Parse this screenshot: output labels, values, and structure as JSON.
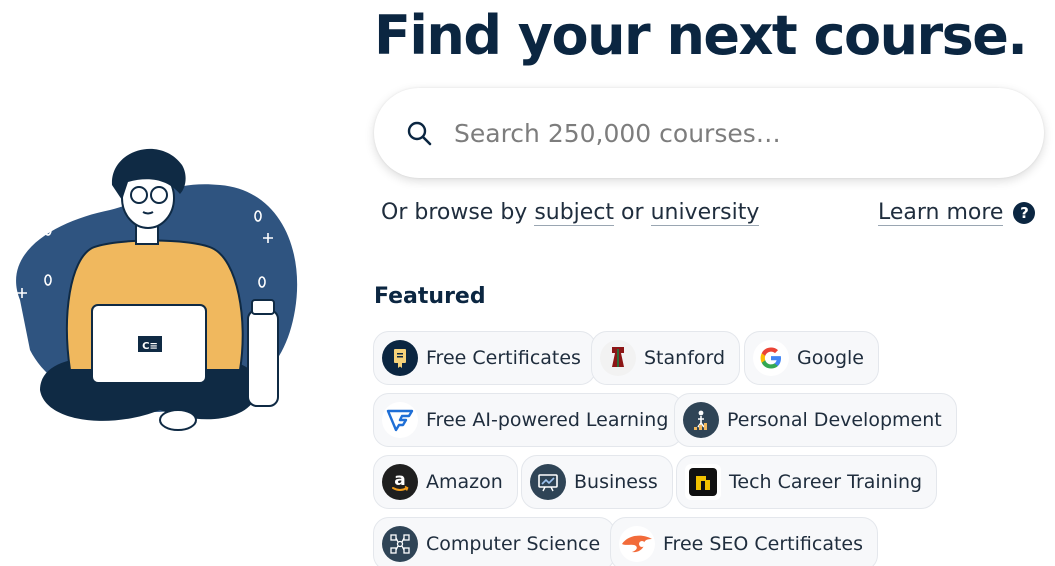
{
  "hero": {
    "title": "Find your next course."
  },
  "search": {
    "placeholder": "Search 250,000 courses…"
  },
  "browse": {
    "prefix": "Or browse by ",
    "subject_link": "subject",
    "middle": " or ",
    "university_link": "university",
    "learn_more": "Learn more",
    "help_glyph": "?"
  },
  "featured": {
    "heading": "Featured",
    "chips": [
      {
        "label": "Free Certificates",
        "icon": "certificate-icon"
      },
      {
        "label": "Stanford",
        "icon": "stanford-logo-icon"
      },
      {
        "label": "Google",
        "icon": "google-logo-icon"
      },
      {
        "label": "Free AI-powered Learning",
        "icon": "ai-learning-logo-icon"
      },
      {
        "label": "Personal Development",
        "icon": "personal-development-icon"
      },
      {
        "label": "Amazon",
        "icon": "amazon-logo-icon"
      },
      {
        "label": "Business",
        "icon": "business-icon"
      },
      {
        "label": "Tech Career Training",
        "icon": "tech-career-logo-icon"
      },
      {
        "label": "Computer Science",
        "icon": "computer-science-icon"
      },
      {
        "label": "Free SEO Certificates",
        "icon": "seo-logo-icon"
      }
    ]
  },
  "laptop_logo": "C≡",
  "colors": {
    "navy": "#0b2641",
    "blob": "#2f5480",
    "sweater": "#f0b85e",
    "chip_bg": "#f7f8fa",
    "seo_orange": "#f26b3a"
  }
}
